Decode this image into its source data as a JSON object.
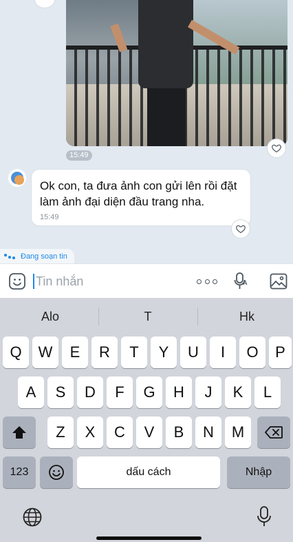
{
  "chat": {
    "photo_time": "15:49",
    "message": {
      "text": "Ok con, ta đưa ảnh con gửi lên rồi đặt làm ảnh đại diện đầu trang nha.",
      "time": "15:49"
    },
    "typing_label": "Đang soạn tin"
  },
  "input": {
    "placeholder": "Tin nhắn"
  },
  "keyboard": {
    "suggestions": [
      "Alo",
      "T",
      "Hk"
    ],
    "row1": [
      "Q",
      "W",
      "E",
      "R",
      "T",
      "Y",
      "U",
      "I",
      "O",
      "P"
    ],
    "row2": [
      "A",
      "S",
      "D",
      "F",
      "G",
      "H",
      "J",
      "K",
      "L"
    ],
    "row3": [
      "Z",
      "X",
      "C",
      "V",
      "B",
      "N",
      "M"
    ],
    "numbers_label": "123",
    "space_label": "dấu cách",
    "return_label": "Nhập"
  },
  "colors": {
    "accent": "#1e88e5",
    "chat_bg": "#e2e9f1",
    "keyboard_bg": "#d2d5db"
  }
}
